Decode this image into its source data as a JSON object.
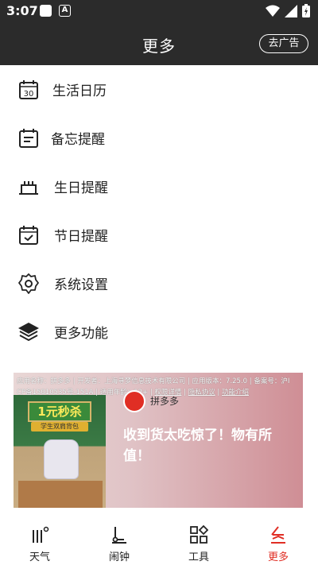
{
  "status_bar": {
    "time": "3:07"
  },
  "header": {
    "title": "更多",
    "ad_button": "去广告"
  },
  "menu": {
    "items": [
      {
        "label": "生活日历",
        "icon": "calendar-30-icon",
        "badge": "30"
      },
      {
        "label": "备忘提醒",
        "icon": "memo-icon"
      },
      {
        "label": "生日提醒",
        "icon": "birthday-cake-icon"
      },
      {
        "label": "节日提醒",
        "icon": "holiday-calendar-check-icon"
      },
      {
        "label": "系统设置",
        "icon": "gear-icon"
      },
      {
        "label": "更多功能",
        "icon": "layers-icon"
      }
    ]
  },
  "ad": {
    "info_line1": "应用名称：拼多多 | 开发者：上海寻梦信息技术有限公司 | 应用版本：7.25.0 | 备案号：沪I",
    "info_line2_prefix": "CP备15010535号-151A | 适用年龄：12+ | ",
    "link_permissions": "权限详情",
    "link_privacy": "隐私协议",
    "link_features": "功能介绍",
    "board_text": "1元秒杀",
    "board_sub": "学生双肩背包",
    "brand": "拼多多",
    "slogan": "收到货太吃惊了！物有所值！"
  },
  "tabbar": {
    "tabs": [
      {
        "label": "天气",
        "icon": "weather-bars-icon",
        "active": false
      },
      {
        "label": "闹钟",
        "icon": "alarm-icon",
        "active": false
      },
      {
        "label": "工具",
        "icon": "tools-grid-icon",
        "active": false
      },
      {
        "label": "更多",
        "icon": "more-icon",
        "active": true
      }
    ],
    "active_color": "#e02e24"
  },
  "colors": {
    "header_bg": "#2b2b2b",
    "accent": "#e02e24"
  }
}
